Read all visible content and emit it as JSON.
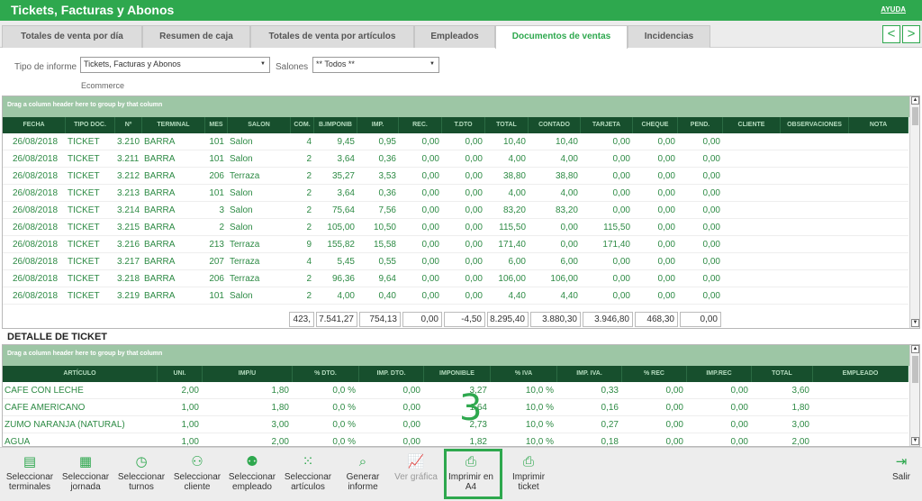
{
  "window": {
    "title": "Tickets, Facturas y Abonos",
    "help": "AYUDA"
  },
  "tabs": [
    "Totales de venta por día",
    "Resumen de caja",
    "Totales de venta por artículos",
    "Empleados",
    "Documentos de ventas",
    "Incidencias"
  ],
  "active_tab": "Documentos de ventas",
  "nav": {
    "prev": "<",
    "next": ">"
  },
  "filters": {
    "tipo_label": "Tipo de informe",
    "tipo_value": "Tickets, Facturas y Abonos",
    "salones_label": "Salones",
    "salones_value": "** Todos **",
    "ecommerce_label": "Ecommerce"
  },
  "group_hint": "Drag a column header here to group by that column",
  "documents": {
    "columns": [
      "FECHA",
      "TIPO DOC.",
      "Nº",
      "TERMINAL",
      "MES",
      "SALON",
      "COM.",
      "B.IMPONIB",
      "IMP.",
      "REC.",
      "T.DTO",
      "TOTAL",
      "CONTADO",
      "TARJETA",
      "CHEQUE",
      "PEND.",
      "CLIENTE",
      "OBSERVACIONES",
      "NOTA"
    ],
    "rows": [
      [
        "26/08/2018",
        "TICKET",
        "3.210",
        "BARRA",
        "101",
        "Salon",
        "4",
        "9,45",
        "0,95",
        "0,00",
        "0,00",
        "10,40",
        "10,40",
        "0,00",
        "0,00",
        "0,00"
      ],
      [
        "26/08/2018",
        "TICKET",
        "3.211",
        "BARRA",
        "101",
        "Salon",
        "2",
        "3,64",
        "0,36",
        "0,00",
        "0,00",
        "4,00",
        "4,00",
        "0,00",
        "0,00",
        "0,00"
      ],
      [
        "26/08/2018",
        "TICKET",
        "3.212",
        "BARRA",
        "206",
        "Terraza",
        "2",
        "35,27",
        "3,53",
        "0,00",
        "0,00",
        "38,80",
        "38,80",
        "0,00",
        "0,00",
        "0,00"
      ],
      [
        "26/08/2018",
        "TICKET",
        "3.213",
        "BARRA",
        "101",
        "Salon",
        "2",
        "3,64",
        "0,36",
        "0,00",
        "0,00",
        "4,00",
        "4,00",
        "0,00",
        "0,00",
        "0,00"
      ],
      [
        "26/08/2018",
        "TICKET",
        "3.214",
        "BARRA",
        "3",
        "Salon",
        "2",
        "75,64",
        "7,56",
        "0,00",
        "0,00",
        "83,20",
        "83,20",
        "0,00",
        "0,00",
        "0,00"
      ],
      [
        "26/08/2018",
        "TICKET",
        "3.215",
        "BARRA",
        "2",
        "Salon",
        "2",
        "105,00",
        "10,50",
        "0,00",
        "0,00",
        "115,50",
        "0,00",
        "115,50",
        "0,00",
        "0,00"
      ],
      [
        "26/08/2018",
        "TICKET",
        "3.216",
        "BARRA",
        "213",
        "Terraza",
        "9",
        "155,82",
        "15,58",
        "0,00",
        "0,00",
        "171,40",
        "0,00",
        "171,40",
        "0,00",
        "0,00"
      ],
      [
        "26/08/2018",
        "TICKET",
        "3.217",
        "BARRA",
        "207",
        "Terraza",
        "4",
        "5,45",
        "0,55",
        "0,00",
        "0,00",
        "6,00",
        "6,00",
        "0,00",
        "0,00",
        "0,00"
      ],
      [
        "26/08/2018",
        "TICKET",
        "3.218",
        "BARRA",
        "206",
        "Terraza",
        "2",
        "96,36",
        "9,64",
        "0,00",
        "0,00",
        "106,00",
        "106,00",
        "0,00",
        "0,00",
        "0,00"
      ],
      [
        "26/08/2018",
        "TICKET",
        "3.219",
        "BARRA",
        "101",
        "Salon",
        "2",
        "4,00",
        "0,40",
        "0,00",
        "0,00",
        "4,40",
        "4,40",
        "0,00",
        "0,00",
        "0,00"
      ]
    ],
    "totals": [
      "423,",
      "7.541,27",
      "754,13",
      "0,00",
      "-4,50",
      "8.295,40",
      "3.880,30",
      "3.946,80",
      "468,30",
      "0,00"
    ]
  },
  "detail": {
    "title": "DETALLE DE TICKET",
    "columns": [
      "ARTÍCULO",
      "UNI.",
      "IMP/U",
      "% DTO.",
      "IMP. DTO.",
      "IMPONIBLE",
      "% IVA",
      "IMP. IVA.",
      "% REC",
      "IMP.REC",
      "TOTAL",
      "EMPLEADO"
    ],
    "rows": [
      [
        "CAFE CON LECHE",
        "2,00",
        "1,80",
        "0,0 %",
        "0,00",
        "3,27",
        "10,0 %",
        "0,33",
        "0,00",
        "0,00",
        "3,60"
      ],
      [
        "CAFE AMERICANO",
        "1,00",
        "1,80",
        "0,0 %",
        "0,00",
        "1,64",
        "10,0 %",
        "0,16",
        "0,00",
        "0,00",
        "1,80"
      ],
      [
        "ZUMO NARANJA (NATURAL)",
        "1,00",
        "3,00",
        "0,0 %",
        "0,00",
        "2,73",
        "10,0 %",
        "0,27",
        "0,00",
        "0,00",
        "3,00"
      ],
      [
        "AGUA",
        "1,00",
        "2,00",
        "0,0 %",
        "0,00",
        "1,82",
        "10,0 %",
        "0,18",
        "0,00",
        "0,00",
        "2,00"
      ]
    ]
  },
  "callout_number": "3",
  "toolbar": [
    {
      "label": "Seleccionar terminales",
      "icon": "terminal-icon",
      "glyph": "▤"
    },
    {
      "label": "Seleccionar jornada",
      "icon": "calendar-icon",
      "glyph": "▦"
    },
    {
      "label": "Seleccionar turnos",
      "icon": "clock-icon",
      "glyph": "◷"
    },
    {
      "label": "Seleccionar cliente",
      "icon": "add-user-icon",
      "glyph": "⚇"
    },
    {
      "label": "Seleccionar empleado",
      "icon": "user-icon",
      "glyph": "⚉"
    },
    {
      "label": "Seleccionar artículos",
      "icon": "grid-icon",
      "glyph": "⁙"
    },
    {
      "label": "Generar informe",
      "icon": "search-icon",
      "glyph": "⌕"
    },
    {
      "label": "Ver gráfica",
      "icon": "chart-icon",
      "glyph": "📈"
    },
    {
      "label": "Imprimir en A4",
      "icon": "printer-icon",
      "glyph": "⎙"
    },
    {
      "label": "Imprimir ticket",
      "icon": "printer-icon",
      "glyph": "⎙"
    }
  ],
  "exit": {
    "label": "Salir",
    "icon": "exit-icon",
    "glyph": "⇥"
  }
}
